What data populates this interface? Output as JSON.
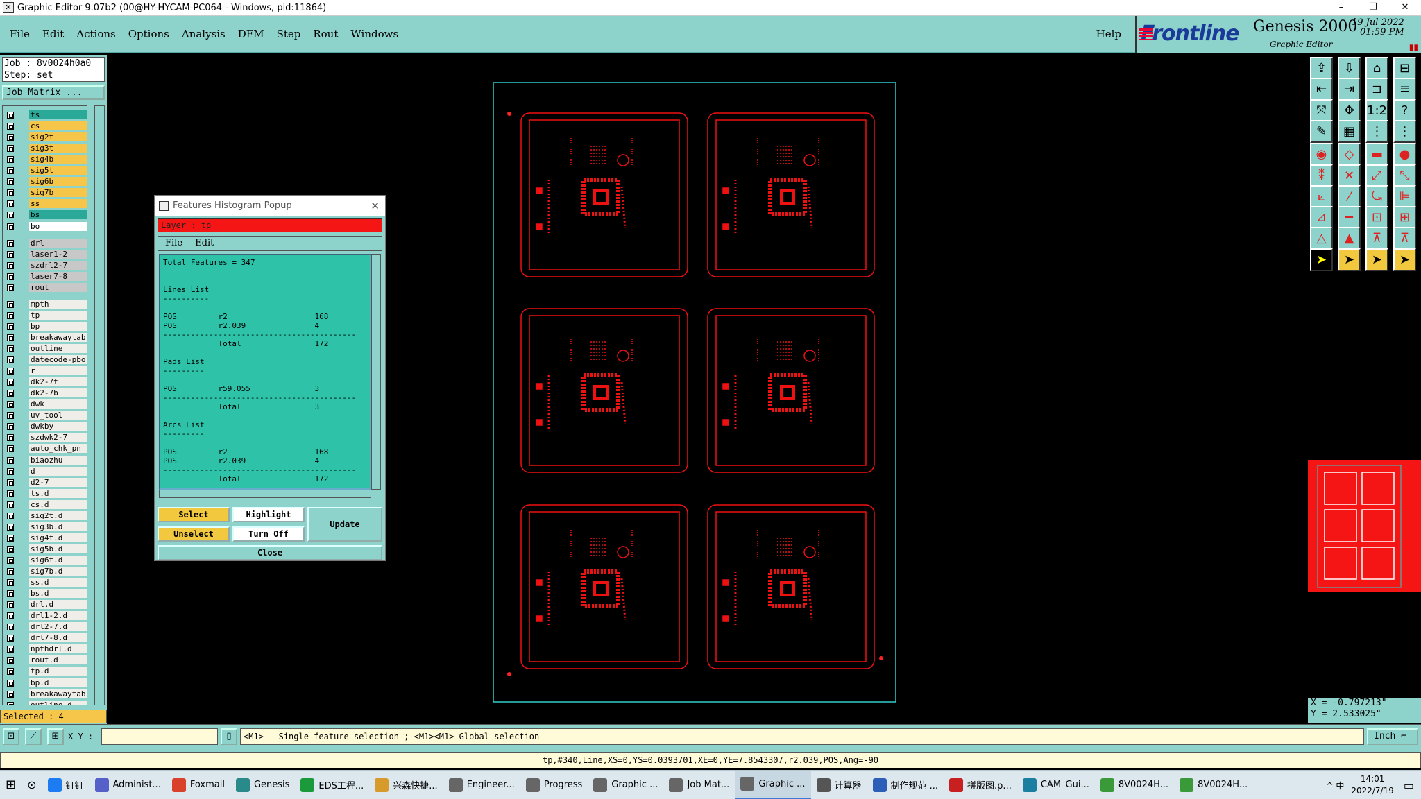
{
  "window": {
    "title": "Graphic Editor 9.07b2 (00@HY-HYCAM-PC064 - Windows, pid:11864)",
    "controls": [
      "–",
      "❐",
      "✕"
    ]
  },
  "menu": {
    "items": [
      "File",
      "Edit",
      "Actions",
      "Options",
      "Analysis",
      "DFM",
      "Step",
      "Rout",
      "Windows"
    ],
    "help": "Help"
  },
  "brand": {
    "logo": "Frontline",
    "product": "Genesis 2000",
    "subtitle": "Graphic Editor",
    "date_line1": "19 Jul 2022",
    "date_line2": "01:59 PM"
  },
  "job": {
    "job_line": "Job : 8v0024h0a0",
    "step_line": "Step: set",
    "matrix_button": "Job Matrix ..."
  },
  "layers": [
    {
      "name": "ts",
      "color": "ts"
    },
    {
      "name": "cs",
      "color": "sig"
    },
    {
      "name": "sig2t",
      "color": "sig"
    },
    {
      "name": "sig3t",
      "color": "sig"
    },
    {
      "name": "sig4b",
      "color": "sig"
    },
    {
      "name": "sig5t",
      "color": "sig"
    },
    {
      "name": "sig6b",
      "color": "sig"
    },
    {
      "name": "sig7b",
      "color": "sig"
    },
    {
      "name": "ss",
      "color": "sig"
    },
    {
      "name": "bs",
      "color": "bs"
    },
    {
      "name": "bo",
      "color": "w"
    },
    {
      "name": "drl",
      "color": "g"
    },
    {
      "name": "laser1-2",
      "color": "g"
    },
    {
      "name": "szdrl2-7",
      "color": "g"
    },
    {
      "name": "laser7-8",
      "color": "g"
    },
    {
      "name": "rout",
      "color": "g"
    },
    {
      "name": "mpth",
      "color": "p"
    },
    {
      "name": "tp",
      "color": "p"
    },
    {
      "name": "bp",
      "color": "p"
    },
    {
      "name": "breakawaytab",
      "color": "p"
    },
    {
      "name": "outline",
      "color": "p"
    },
    {
      "name": "datecode-pbo",
      "color": "p"
    },
    {
      "name": "r",
      "color": "p"
    },
    {
      "name": "dk2-7t",
      "color": "p"
    },
    {
      "name": "dk2-7b",
      "color": "p"
    },
    {
      "name": "dwk",
      "color": "p"
    },
    {
      "name": "uv_tool",
      "color": "p"
    },
    {
      "name": "dwkby",
      "color": "p"
    },
    {
      "name": "szdwk2-7",
      "color": "p"
    },
    {
      "name": "auto_chk_pn",
      "color": "p"
    },
    {
      "name": "biaozhu",
      "color": "p"
    },
    {
      "name": "d",
      "color": "p"
    },
    {
      "name": "d2-7",
      "color": "p"
    },
    {
      "name": "ts.d",
      "color": "p"
    },
    {
      "name": "cs.d",
      "color": "p"
    },
    {
      "name": "sig2t.d",
      "color": "p"
    },
    {
      "name": "sig3b.d",
      "color": "p"
    },
    {
      "name": "sig4t.d",
      "color": "p"
    },
    {
      "name": "sig5b.d",
      "color": "p"
    },
    {
      "name": "sig6t.d",
      "color": "p"
    },
    {
      "name": "sig7b.d",
      "color": "p"
    },
    {
      "name": "ss.d",
      "color": "p"
    },
    {
      "name": "bs.d",
      "color": "p"
    },
    {
      "name": "drl.d",
      "color": "p"
    },
    {
      "name": "drl1-2.d",
      "color": "p"
    },
    {
      "name": "drl2-7.d",
      "color": "p"
    },
    {
      "name": "drl7-8.d",
      "color": "p"
    },
    {
      "name": "npthdrl.d",
      "color": "p"
    },
    {
      "name": "rout.d",
      "color": "p"
    },
    {
      "name": "tp.d",
      "color": "p"
    },
    {
      "name": "bp.d",
      "color": "p"
    },
    {
      "name": "breakawaytab",
      "color": "p"
    },
    {
      "name": "outline.d",
      "color": "p"
    }
  ],
  "selected": "Selected : 4",
  "popup": {
    "title": "Features Histogram Popup",
    "layer_line": "Layer :  tp",
    "menu": [
      "File",
      "Edit"
    ],
    "report_lines": [
      "Total Features = 347",
      "",
      "",
      "Lines List",
      "----------",
      "",
      "POS         r2                   168",
      "POS         r2.039               4",
      "------------------------------------------",
      "            Total                172",
      "",
      "Pads List",
      "---------",
      "",
      "POS         r59.055              3",
      "------------------------------------------",
      "            Total                3",
      "",
      "Arcs List",
      "---------",
      "",
      "POS         r2                   168",
      "POS         r2.039               4",
      "------------------------------------------",
      "            Total                172"
    ],
    "buttons": {
      "select": "Select",
      "highlight": "Highlight",
      "update": "Update",
      "unselect": "Unselect",
      "turn_off": "Turn Off",
      "close": "Close"
    }
  },
  "coords": {
    "x": "X = -0.797213\"",
    "y": "Y = 2.533025\""
  },
  "status": {
    "xy_label": "X Y :",
    "hint": "<M1> - Single feature selection ; <M1><M1> Global selection",
    "units": "Inch ⌐",
    "info": "tp,#340,Line,XS=0,YS=0.0393701,XE=0,YE=7.8543307,r2.039,POS,Ang=-90"
  },
  "taskbar": {
    "items": [
      {
        "label": "钉钉",
        "color": "#1d7cf2"
      },
      {
        "label": "Administ...",
        "color": "#5560c8"
      },
      {
        "label": "Foxmail",
        "color": "#d9412b"
      },
      {
        "label": "Genesis",
        "color": "#2a8a8a"
      },
      {
        "label": "EDS工程...",
        "color": "#1a9a3a"
      },
      {
        "label": "兴森快捷...",
        "color": "#d69b2a"
      },
      {
        "label": "Engineer...",
        "color": "#666"
      },
      {
        "label": "Progress",
        "color": "#666"
      },
      {
        "label": "Graphic ...",
        "color": "#666"
      },
      {
        "label": "Job Mat...",
        "color": "#666"
      },
      {
        "label": "Graphic ...",
        "color": "#666",
        "active": true
      },
      {
        "label": "计算器",
        "color": "#555"
      },
      {
        "label": "制作规范 ...",
        "color": "#2b5fb8"
      },
      {
        "label": "拼版图.p...",
        "color": "#c82020"
      },
      {
        "label": "CAM_Gui...",
        "color": "#1a7fa0"
      },
      {
        "label": "8V0024H...",
        "color": "#3a9a3a"
      },
      {
        "label": "8V0024H...",
        "color": "#3a9a3a"
      }
    ],
    "tray": "^  中",
    "time": "14:01",
    "date": "2022/7/19"
  }
}
